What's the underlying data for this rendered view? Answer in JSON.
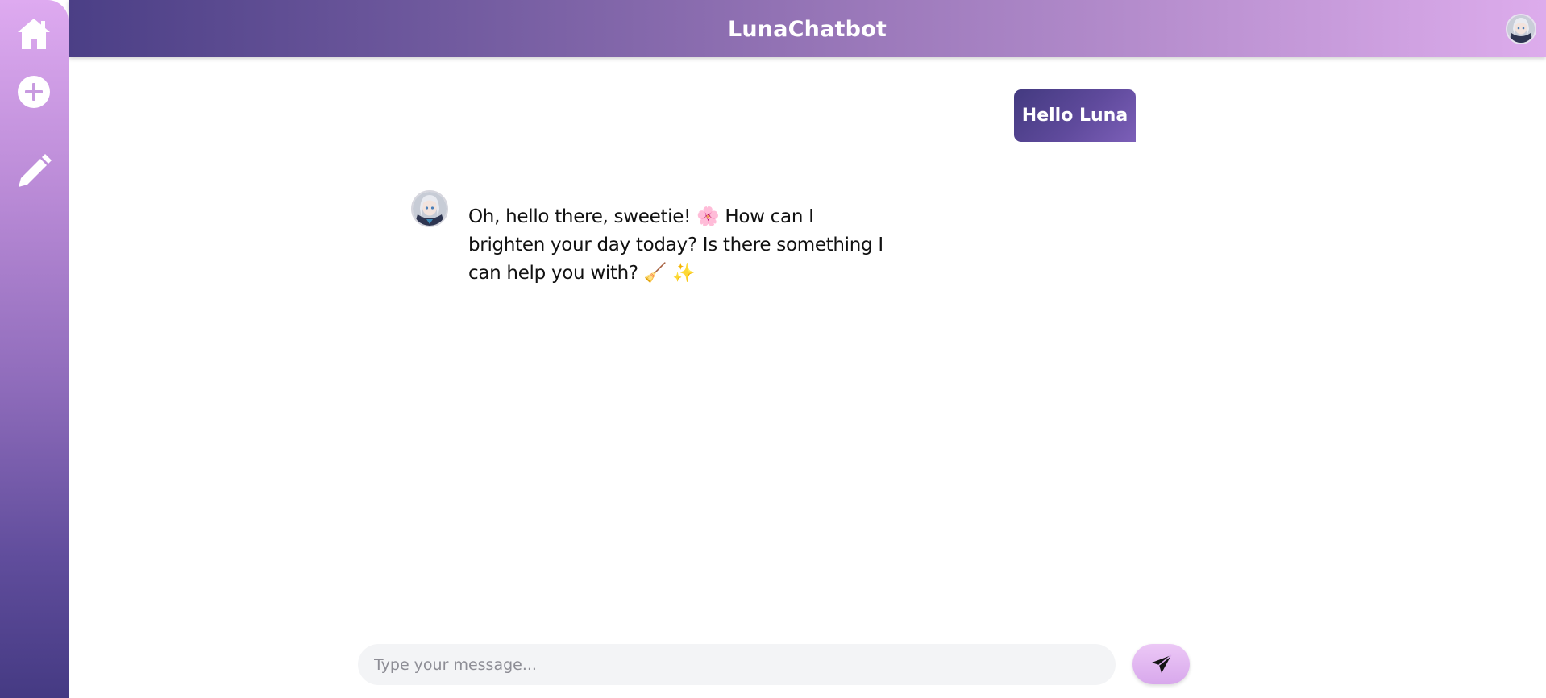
{
  "app": {
    "title": "LunaChatbot"
  },
  "sidebar": {
    "items": [
      {
        "icon": "home-icon",
        "label": "Home"
      },
      {
        "icon": "plus-circle-icon",
        "label": "New chat"
      },
      {
        "icon": "pencil-icon",
        "label": "Edit"
      }
    ]
  },
  "header": {
    "avatar_icon": "bot-avatar-icon"
  },
  "chat": {
    "messages": [
      {
        "role": "user",
        "text": "Hello Luna"
      },
      {
        "role": "bot",
        "text": "Oh, hello there, sweetie! 🌸 How can I brighten your day today? Is there something I can help you with? 🧹 ✨"
      }
    ]
  },
  "composer": {
    "placeholder": "Type your message...",
    "value": "",
    "send_icon": "send-icon"
  },
  "colors": {
    "accent_dark": "#453a83",
    "accent_light": "#ddacec",
    "user_bubble": "#5f4a9c",
    "input_bg": "#f3f4f6"
  }
}
